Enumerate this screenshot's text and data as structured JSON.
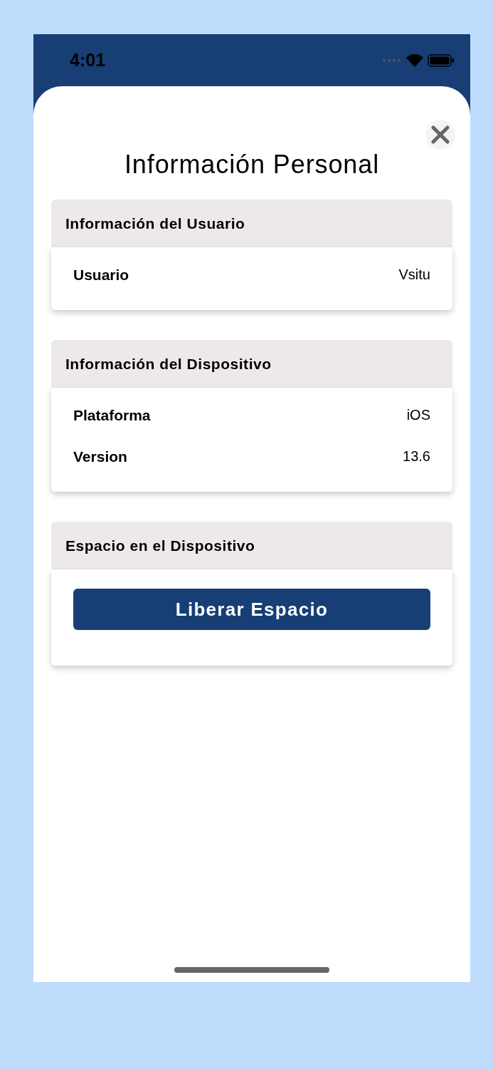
{
  "status_bar": {
    "time": "4:01"
  },
  "title": "Información Personal",
  "sections": [
    {
      "kind": "info",
      "title": "Información del Usuario",
      "rows": [
        {
          "label": "Usuario",
          "value": "Vsitu"
        }
      ]
    },
    {
      "kind": "info",
      "title": "Información del Dispositivo",
      "rows": [
        {
          "label": "Plataforma",
          "value": "iOS"
        },
        {
          "label": "Version",
          "value": "13.6"
        }
      ]
    },
    {
      "kind": "action",
      "title": "Espacio en el Dispositivo",
      "button": "Liberar Espacio"
    }
  ]
}
